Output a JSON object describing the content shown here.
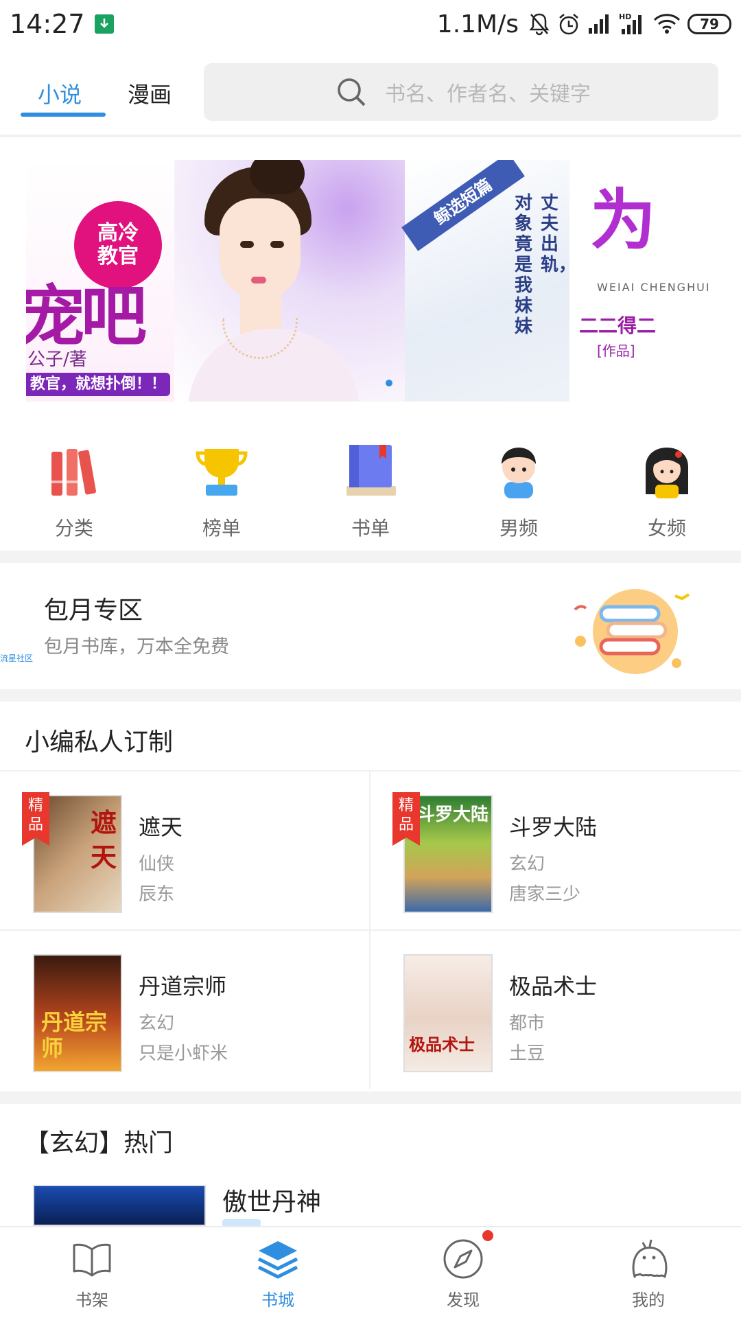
{
  "status_bar": {
    "time": "14:27",
    "net_speed": "1.1M/s",
    "battery": "79",
    "icons": [
      "download-icon",
      "mute-icon",
      "alarm-icon",
      "signal-icon",
      "hd-signal-icon",
      "wifi-icon",
      "battery-icon"
    ]
  },
  "top_tabs": [
    {
      "label": "小说",
      "active": true
    },
    {
      "label": "漫画",
      "active": false
    }
  ],
  "search": {
    "placeholder": "书名、作者名、关键字"
  },
  "banner": {
    "slides": [
      {
        "badge": "高冷教官",
        "title_fragment": "宠吧",
        "author": "公子/著",
        "tagline": "教官，就想扑倒！！"
      },
      {
        "ribbon": "鲸选短篇",
        "vertical_1": "丈夫出轨，",
        "vertical_2": "对象竟是我妹妹"
      },
      {
        "title_fragment": "为",
        "english": "WEIAI CHENGHUI",
        "author": "二二得二",
        "work_label": "[作品]"
      }
    ],
    "active_index": 0
  },
  "categories": [
    {
      "label": "分类",
      "icon": "books-icon"
    },
    {
      "label": "榜单",
      "icon": "trophy-icon"
    },
    {
      "label": "书单",
      "icon": "book-icon"
    },
    {
      "label": "男频",
      "icon": "boy-icon"
    },
    {
      "label": "女频",
      "icon": "girl-icon"
    }
  ],
  "monthly": {
    "title": "包月专区",
    "subtitle": "包月书库，万本全免费",
    "watermark": "流星社区"
  },
  "picks": {
    "title": "小编私人订制",
    "badge_label": "精品",
    "books": [
      {
        "name": "遮天",
        "genre": "仙侠",
        "author": "辰东",
        "premium": true,
        "cover_text": "遮天"
      },
      {
        "name": "斗罗大陆",
        "genre": "玄幻",
        "author": "唐家三少",
        "premium": true,
        "cover_text": "斗罗大陆"
      },
      {
        "name": "丹道宗师",
        "genre": "玄幻",
        "author": "只是小虾米",
        "premium": false,
        "cover_text": "丹道宗师"
      },
      {
        "name": "极品术士",
        "genre": "都市",
        "author": "土豆",
        "premium": false,
        "cover_text": "极品术士"
      }
    ]
  },
  "hot": {
    "title": "【玄幻】热门",
    "first_book": "傲世丹神"
  },
  "bottom_nav": [
    {
      "label": "书架",
      "icon": "bookshelf-icon",
      "active": false
    },
    {
      "label": "书城",
      "icon": "bookstore-icon",
      "active": true
    },
    {
      "label": "发现",
      "icon": "compass-icon",
      "active": false,
      "has_dot": true
    },
    {
      "label": "我的",
      "icon": "profile-icon",
      "active": false
    }
  ],
  "colors": {
    "accent": "#2f8ee0",
    "badge_red": "#e8382e"
  }
}
